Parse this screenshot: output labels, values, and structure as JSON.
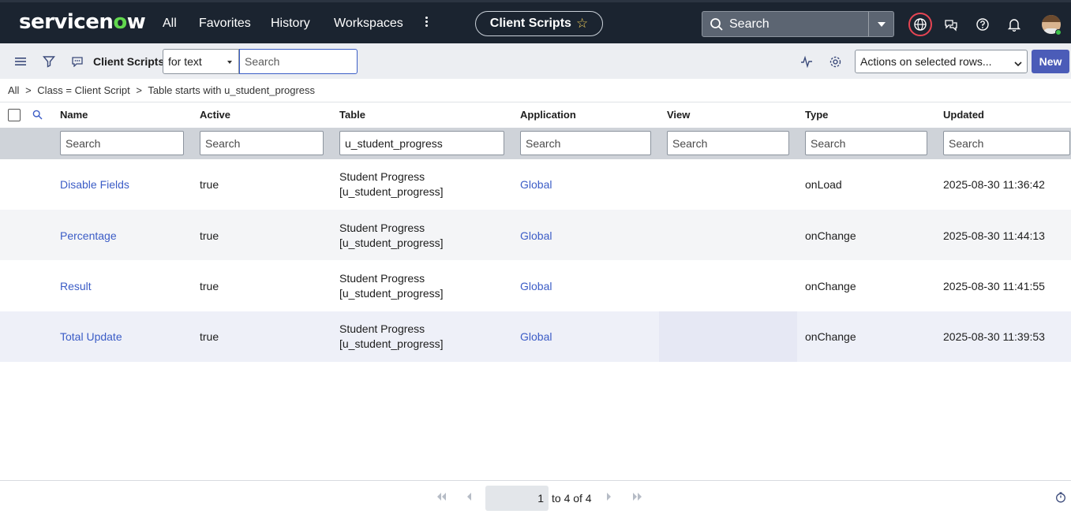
{
  "nav": {
    "logo_text_a": "servicen",
    "logo_text_o": "o",
    "logo_text_b": "w",
    "links": [
      "All",
      "Favorites",
      "History",
      "Workspaces"
    ],
    "context_pill": "Client Scripts",
    "search_placeholder": "Search",
    "accent_globe": "#e64553"
  },
  "toolbar": {
    "title": "Client Scripts",
    "search_type": "for text",
    "search_placeholder": "Search",
    "actions_label": "Actions on selected rows...",
    "new_label": "New"
  },
  "breadcrumb": [
    "All",
    ">",
    "Class = Client Script",
    ">",
    "Table starts with u_student_progress"
  ],
  "columns": [
    "Name",
    "Active",
    "Table",
    "Application",
    "View",
    "Type",
    "Updated"
  ],
  "filters": {
    "name": "Search",
    "active": "Search",
    "table": "u_student_progress",
    "application": "Search",
    "view": "Search",
    "type": "Search",
    "updated": "Search"
  },
  "rows": [
    {
      "name": "Disable Fields",
      "active": "true",
      "table_line1": "Student Progress",
      "table_line2": "[u_student_progress]",
      "application": "Global",
      "view": "",
      "type": "onLoad",
      "updated": "2025-08-30 11:36:42"
    },
    {
      "name": "Percentage",
      "active": "true",
      "table_line1": "Student Progress",
      "table_line2": "[u_student_progress]",
      "application": "Global",
      "view": "",
      "type": "onChange",
      "updated": "2025-08-30 11:44:13"
    },
    {
      "name": "Result",
      "active": "true",
      "table_line1": "Student Progress",
      "table_line2": "[u_student_progress]",
      "application": "Global",
      "view": "",
      "type": "onChange",
      "updated": "2025-08-30 11:41:55"
    },
    {
      "name": "Total Update",
      "active": "true",
      "table_line1": "Student Progress",
      "table_line2": "[u_student_progress]",
      "application": "Global",
      "view": "",
      "type": "onChange",
      "updated": "2025-08-30 11:39:53"
    }
  ],
  "pagination": {
    "current": "1",
    "summary": "to 4 of 4"
  }
}
